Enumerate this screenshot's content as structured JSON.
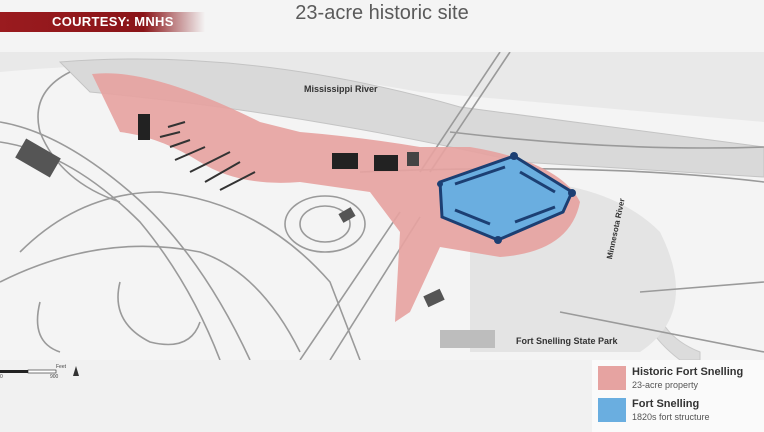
{
  "banner": {
    "courtesy": "COURTESY: MNHS"
  },
  "title": "23-acre historic site",
  "map": {
    "labels": {
      "river": "Mississippi River",
      "minnesota_river": "Minnesota River",
      "park": "Fort Snelling State Park"
    },
    "scale": {
      "unit": "Feet",
      "left_tick": "0",
      "right_tick": "900"
    }
  },
  "legend": {
    "items": [
      {
        "title": "Historic Fort Snelling",
        "subtitle": "23-acre property",
        "color": "#e6a3a1"
      },
      {
        "title": "Fort Snelling",
        "subtitle": "1820s fort structure",
        "color": "#6aaee0"
      }
    ]
  },
  "colors": {
    "banner": "#8a1418",
    "property": "#e6a3a1",
    "fort": "#6aaee0"
  }
}
